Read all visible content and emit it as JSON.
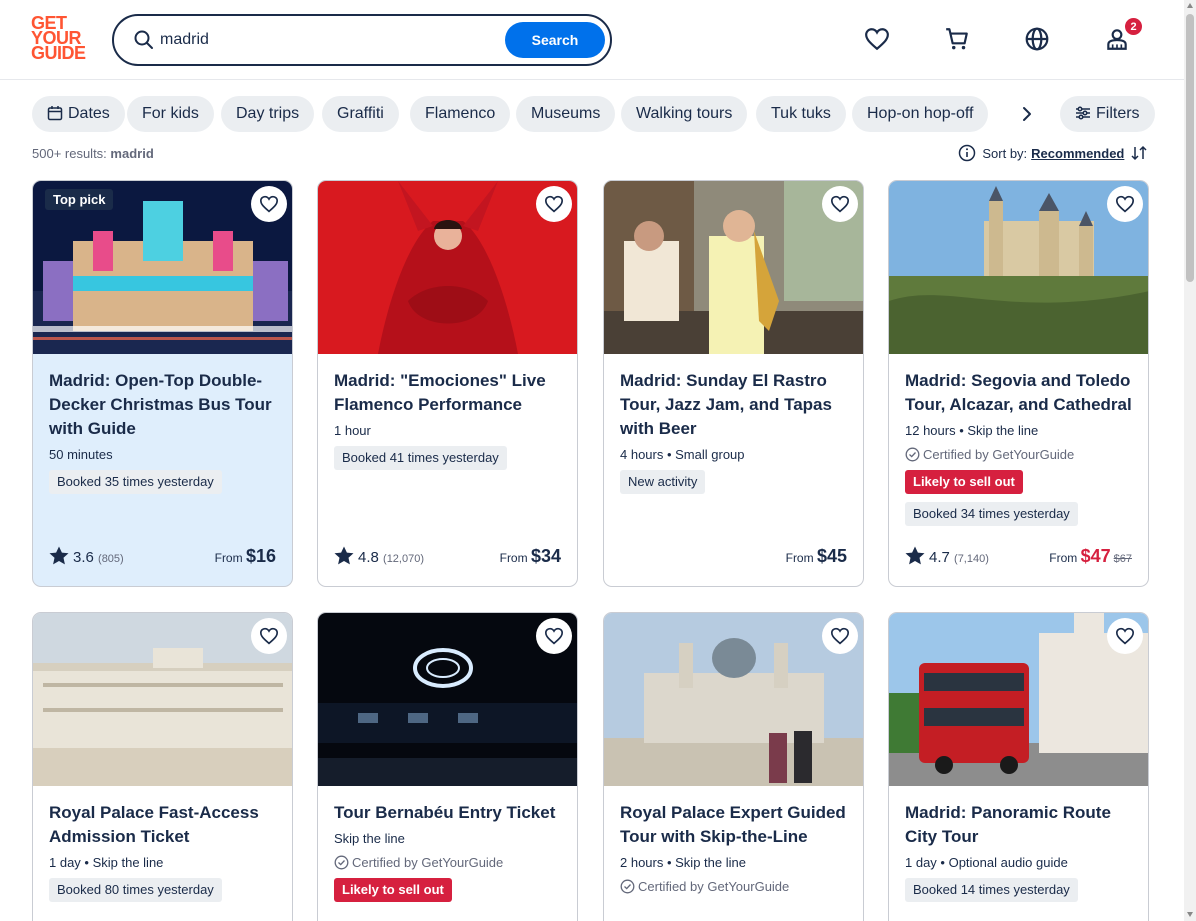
{
  "header": {
    "logo_lines": [
      "GET",
      "YOUR",
      "GUIDE"
    ],
    "search_value": "madrid",
    "search_button": "Search",
    "icons": [
      "heart-icon",
      "cart-icon",
      "globe-icon",
      "user-icon"
    ],
    "notification_count": "2"
  },
  "filters": {
    "chips": [
      "Dates",
      "For kids",
      "Day trips",
      "Graffiti",
      "Flamenco",
      "Museums",
      "Walking tours",
      "Tuk tuks",
      "Hop-on hop-off"
    ],
    "filters_label": "Filters"
  },
  "results": {
    "count_label": "500+ results:",
    "query": "madrid",
    "sort_label": "Sort by:",
    "sort_value": "Recommended"
  },
  "cards": [
    {
      "badge": "Top pick",
      "title": "Madrid: Open-Top Double-Decker Christmas Bus Tour with Guide",
      "meta": "50 minutes",
      "booked": "Booked 35 times yesterday",
      "rating": "3.6",
      "reviews": "(805)",
      "price_from": "From",
      "price": "$16"
    },
    {
      "title": "Madrid: \"Emociones\" Live Flamenco Performance",
      "meta": "1 hour",
      "booked": "Booked 41 times yesterday",
      "rating": "4.8",
      "reviews": "(12,070)",
      "price_from": "From",
      "price": "$34"
    },
    {
      "title": "Madrid: Sunday El Rastro Tour, Jazz Jam, and Tapas with Beer",
      "meta": "4 hours • Small group",
      "new": "New activity",
      "price_from": "From",
      "price": "$45"
    },
    {
      "title": "Madrid: Segovia and Toledo Tour, Alcazar, and Cathedral",
      "meta": "12 hours • Skip the line",
      "certified": "Certified by GetYourGuide",
      "sell_out": "Likely to sell out",
      "booked": "Booked 34 times yesterday",
      "rating": "4.7",
      "reviews": "(7,140)",
      "price_from": "From",
      "price": "$47",
      "old_price": "$67"
    },
    {
      "title": "Royal Palace Fast-Access Admission Ticket",
      "meta": "1 day • Skip the line",
      "booked": "Booked 80 times yesterday"
    },
    {
      "title": "Tour Bernabéu Entry Ticket",
      "meta": "Skip the line",
      "certified": "Certified by GetYourGuide",
      "sell_out": "Likely to sell out"
    },
    {
      "title": "Royal Palace Expert Guided Tour with Skip-the-Line",
      "meta": "2 hours • Skip the line",
      "certified": "Certified by GetYourGuide"
    },
    {
      "title": "Madrid: Panoramic Route City Tour",
      "meta": "1 day • Optional audio guide",
      "booked": "Booked 14 times yesterday"
    }
  ],
  "colors": {
    "accent": "#0071eb",
    "brand": "#ff5533",
    "navy": "#1a2b49",
    "sale": "#d6203f"
  }
}
